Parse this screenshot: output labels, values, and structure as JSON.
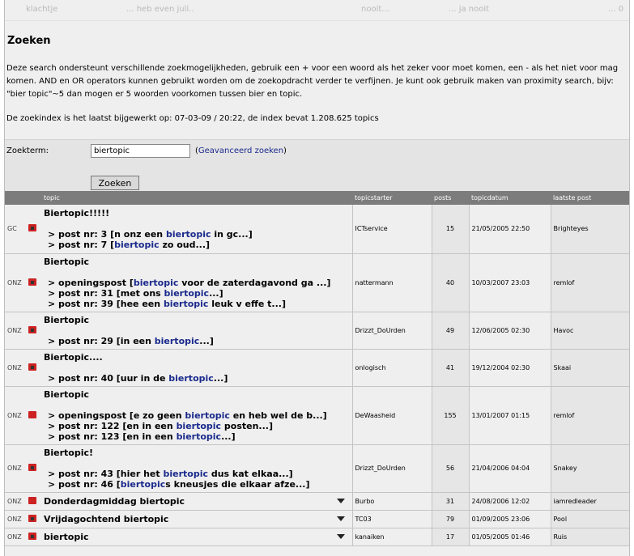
{
  "top_fragments": [
    "klachtje",
    "... heb even juli..",
    "nooit...",
    "... ja nooit",
    "... 0"
  ],
  "heading": "Zoeken",
  "intro": "Deze search ondersteunt verschillende zoekmogelijkheden, gebruik een + voor een woord als het zeker voor moet komen, een - als het niet voor mag komen. AND en OR operators kunnen gebruikt worden om de zoekopdracht verder te verfijnen. Je kunt ook gebruik maken van proximity search, bijv: \"bier topic\"~5 dan mogen er 5 woorden voorkomen tussen bier en topic.",
  "index_info": "De zoekindex is het laatst bijgewerkt op: 07-03-09 / 20:22, de index bevat 1.208.625 topics",
  "search": {
    "label": "Zoekterm:",
    "value": "biertopic",
    "advanced_prefix": "(",
    "advanced_link": "Geavanceerd zoeken",
    "advanced_suffix": ")",
    "button": "Zoeken"
  },
  "columns": {
    "topic": "topic",
    "starter": "topicstarter",
    "posts": "posts",
    "date": "topicdatum",
    "last": "laatste post"
  },
  "rows": [
    {
      "cat": "GC",
      "title": "Biertopic!!!!!",
      "starter": "ICTservice",
      "posts": "15",
      "date": "21/05/2005 22:50",
      "last": "Brighteyes",
      "lock": true,
      "hits": [
        {
          "pre": "> post nr: 3 [n onz een ",
          "hl": "biertopic",
          "post": " in gc...]"
        },
        {
          "pre": "> post nr: 7 [",
          "hl": "biertopic",
          "post": " zo oud...]"
        }
      ]
    },
    {
      "cat": "ONZ",
      "title": "Biertopic",
      "starter": "nattermann",
      "posts": "40",
      "date": "10/03/2007 23:03",
      "last": "remlof",
      "lock": true,
      "hits": [
        {
          "pre": "> openingspost [",
          "hl": "biertopic",
          "post": " voor de zaterdagavond ga ...]"
        },
        {
          "pre": "> post nr: 31 [met ons ",
          "hl": "biertopic",
          "post": "...]"
        },
        {
          "pre": "> post nr: 39 [hee een ",
          "hl": "biertopic",
          "post": " leuk v effe t...]"
        }
      ]
    },
    {
      "cat": "ONZ",
      "title": "Biertopic",
      "starter": "Drizzt_DoUrden",
      "posts": "49",
      "date": "12/06/2005 02:30",
      "last": "Havoc",
      "lock": true,
      "hits": [
        {
          "pre": "> post nr: 29 [in een ",
          "hl": "biertopic",
          "post": "...]"
        }
      ]
    },
    {
      "cat": "ONZ",
      "title": "Biertopic....",
      "starter": "onlogisch",
      "posts": "41",
      "date": "19/12/2004 02:30",
      "last": "Skaai",
      "lock": true,
      "hits": [
        {
          "pre": "> post nr: 40 [uur in de ",
          "hl": "biertopic",
          "post": "...]"
        }
      ]
    },
    {
      "cat": "ONZ",
      "title": "Biertopic",
      "starter": "DeWaasheid",
      "posts": "155",
      "date": "13/01/2007 01:15",
      "last": "remlof",
      "lock": false,
      "hits": [
        {
          "pre": "> openingspost [e zo geen ",
          "hl": "biertopic",
          "post": " en heb wel de b...]"
        },
        {
          "pre": "> post nr: 122 [en in een ",
          "hl": "biertopic",
          "post": " posten...]"
        },
        {
          "pre": "> post nr: 123 [en in een ",
          "hl": "biertopic",
          "post": "...]"
        }
      ]
    },
    {
      "cat": "ONZ",
      "title": "Biertopic!",
      "starter": "Drizzt_DoUrden",
      "posts": "56",
      "date": "21/04/2006 04:04",
      "last": "Snakey",
      "lock": true,
      "hits": [
        {
          "pre": "> post nr: 43 [hier het ",
          "hl": "biertopic",
          "post": " dus kat elkaa...]"
        },
        {
          "pre": "> post nr: 46 [",
          "hl": "biertopic",
          "post": "s kneusjes die elkaar afze...]"
        }
      ]
    },
    {
      "cat": "ONZ",
      "title": "Donderdagmiddag biertopic",
      "starter": "Burbo",
      "posts": "31",
      "date": "24/08/2006 12:02",
      "last": "iamredleader",
      "lock": false,
      "collapsed": true,
      "hits": []
    },
    {
      "cat": "ONZ",
      "title": "Vrijdagochtend biertopic",
      "starter": "TC03",
      "posts": "79",
      "date": "01/09/2005 23:06",
      "last": "Pool",
      "lock": true,
      "collapsed": true,
      "hits": []
    },
    {
      "cat": "ONZ",
      "title": "biertopic",
      "starter": "kanaiken",
      "posts": "17",
      "date": "01/05/2005 01:46",
      "last": "Ruis",
      "lock": true,
      "collapsed": true,
      "hits": []
    }
  ],
  "colors": {
    "header_bg": "#7c7c7c",
    "highlight": "#1a2a8c",
    "folder": "#cc2222"
  }
}
